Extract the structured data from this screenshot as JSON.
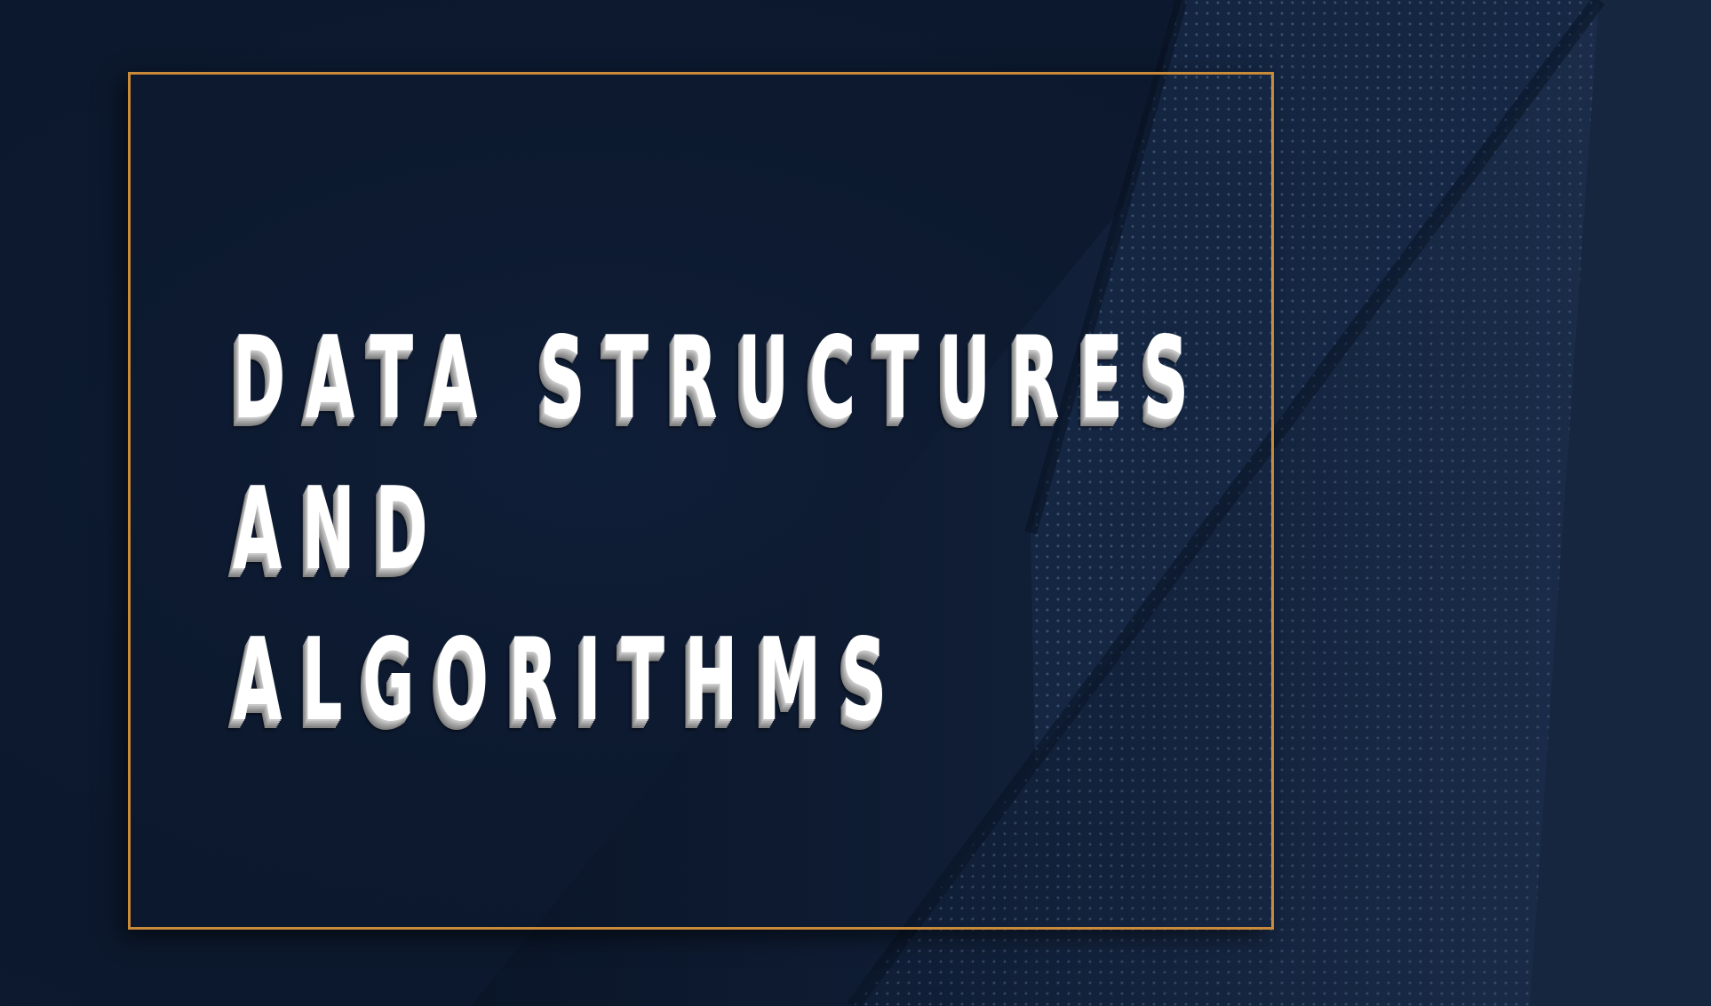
{
  "banner": {
    "title_line_1": "DATA STRUCTURES",
    "title_line_2": "AND",
    "title_line_3": "ALGORITHMS"
  },
  "colors": {
    "background": "#0c1a2e",
    "frame_border": "#c98a3a",
    "text": "#ffffff"
  }
}
